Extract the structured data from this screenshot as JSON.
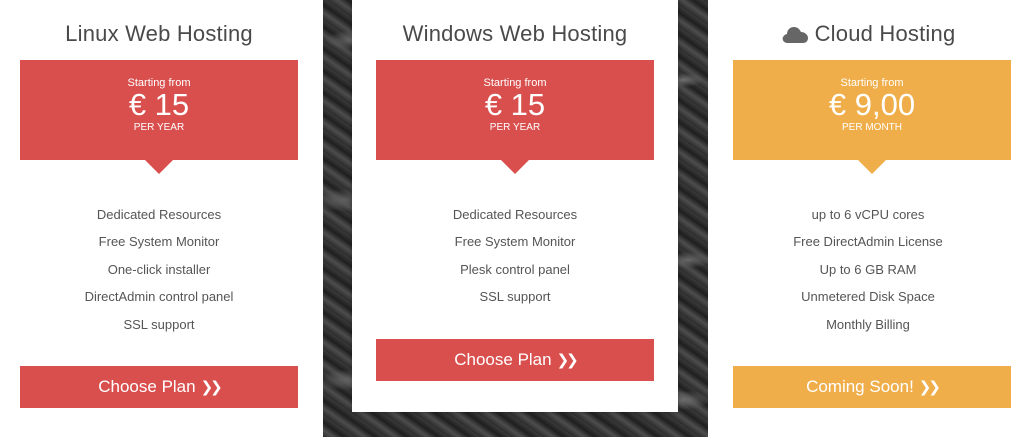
{
  "colors": {
    "red": "#d94f4e",
    "orange": "#f0ae4a"
  },
  "plans": [
    {
      "title": "Linux Web Hosting",
      "starting_from": "Starting from",
      "price": "€ 15",
      "period": "PER YEAR",
      "features": [
        "Dedicated Resources",
        "Free System Monitor",
        "One-click installer",
        "DirectAdmin control panel",
        "SSL support"
      ],
      "button_label": "Choose Plan",
      "button_icon": "double-chevron-right-icon"
    },
    {
      "title": "Windows Web Hosting",
      "starting_from": "Starting from",
      "price": "€ 15",
      "period": "PER YEAR",
      "features": [
        "Dedicated Resources",
        "Free System Monitor",
        "Plesk control panel",
        "SSL support"
      ],
      "button_label": "Choose Plan",
      "button_icon": "double-chevron-right-icon"
    },
    {
      "title": "Cloud Hosting",
      "title_icon": "cloud-icon",
      "starting_from": "Starting from",
      "price": "€ 9,00",
      "period": "PER MONTH",
      "features": [
        "up to 6 vCPU cores",
        "Free DirectAdmin License",
        "Up to 6 GB RAM",
        "Unmetered Disk Space",
        "Monthly Billing"
      ],
      "button_label": "Coming Soon!",
      "button_icon": "double-chevron-right-icon"
    }
  ]
}
